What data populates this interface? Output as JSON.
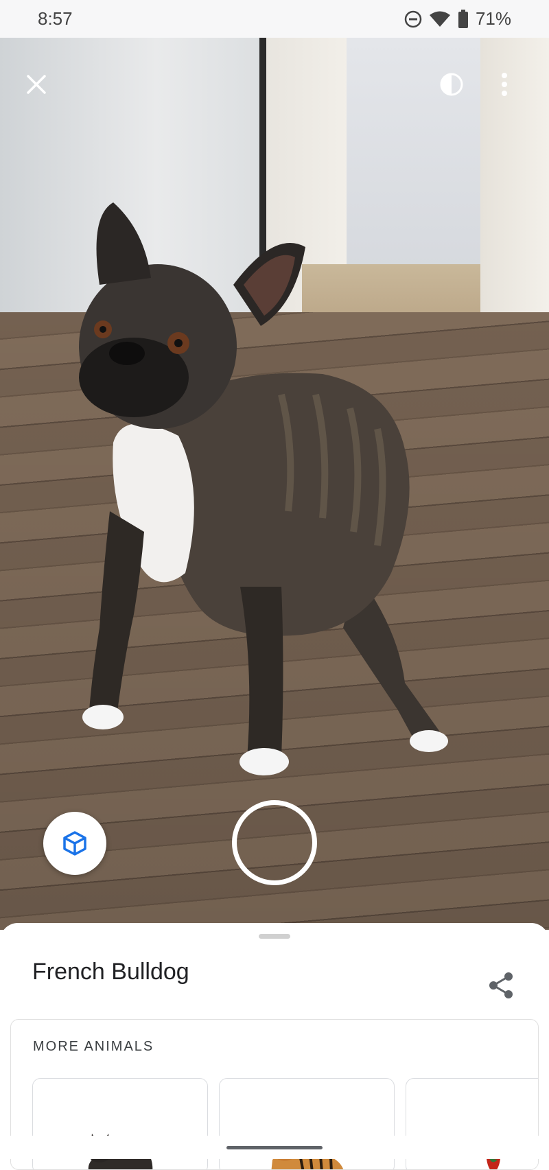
{
  "status_bar": {
    "time": "8:57",
    "battery": "71%"
  },
  "ar_view": {
    "close_icon": "close-icon",
    "contrast_icon": "contrast-icon",
    "more_icon": "more-vert-icon",
    "cube_icon": "3d-cube-icon"
  },
  "sheet": {
    "title": "French Bulldog",
    "share_icon": "share-icon",
    "more_label": "MORE ANIMALS",
    "thumbnails": [
      "French Bulldog",
      "Tiger",
      "Parrot"
    ]
  },
  "colors": {
    "accent": "#1a73e8"
  }
}
